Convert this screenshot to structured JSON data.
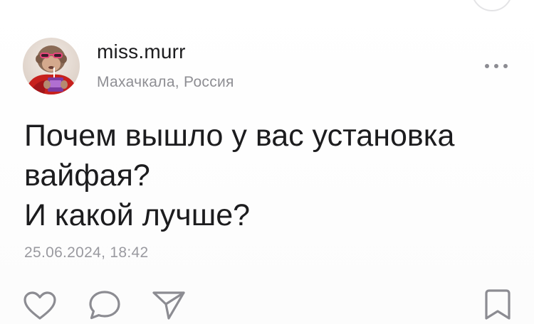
{
  "post": {
    "author": {
      "username": "miss.murr",
      "location": "Махачкала, Россия"
    },
    "text_lines": [
      "Почем вышло у вас установка",
      "вайфая?",
      "И какой лучше?"
    ],
    "timestamp": "25.06.2024, 18:42"
  },
  "icons": {
    "more": "more-horizontal-icon",
    "like": "heart-icon",
    "comment": "comment-bubble-icon",
    "share": "send-arrow-icon",
    "bookmark": "bookmark-icon"
  },
  "colors": {
    "text": "#1c1c1e",
    "secondary": "#8e8e93",
    "icon": "#8c8c92"
  }
}
